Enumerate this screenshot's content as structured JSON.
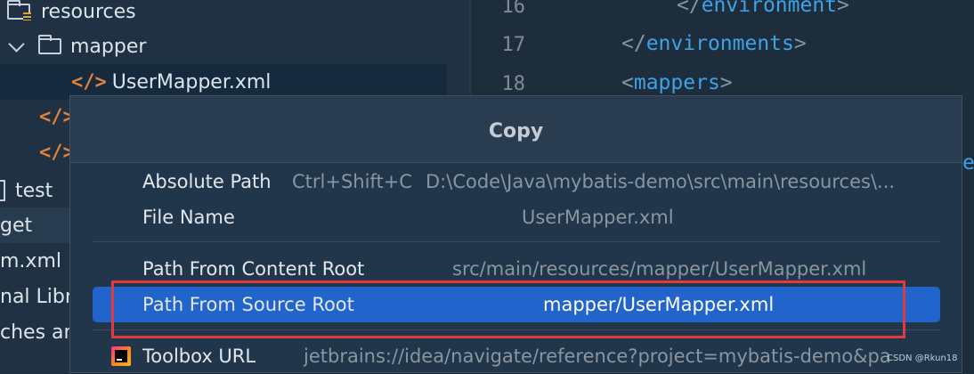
{
  "sidebar": {
    "resources_label": "resources",
    "mapper_label": "mapper",
    "file_label": "UserMapper.xml",
    "fragments": [
      "test",
      "get",
      "m.xml",
      "nal Libra",
      "ches and"
    ]
  },
  "editor": {
    "lines": [
      {
        "num": "16",
        "open": "</",
        "name": "environment",
        "close": ">"
      },
      {
        "num": "17",
        "open": "</",
        "name": "environments",
        "close": ">"
      },
      {
        "num": "18",
        "open": "<",
        "name": "mappers",
        "close": ">"
      }
    ],
    "hint": "e"
  },
  "popup": {
    "title": "Copy",
    "items": [
      {
        "label": "Absolute Path",
        "shortcut": "Ctrl+Shift+C",
        "value": "D:\\Code\\Java\\mybatis-demo\\src\\main\\resources\\..."
      },
      {
        "label": "File Name",
        "value": "UserMapper.xml"
      },
      {
        "label": "Path From Content Root",
        "value": "src/main/resources/mapper/UserMapper.xml"
      },
      {
        "label": "Path From Source Root",
        "value": "mapper/UserMapper.xml",
        "selected": true
      },
      {
        "label": "Toolbox URL",
        "value": "jetbrains://idea/navigate/reference?project=mybatis-demo&pa"
      }
    ]
  },
  "watermark": "CSDN @Rkun18",
  "colors": {
    "selection": "#2165cc",
    "annotation": "#e23a3f",
    "xml_icon": "#e0823d",
    "tag_name": "#3da3e8"
  }
}
